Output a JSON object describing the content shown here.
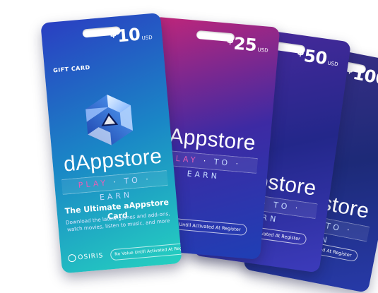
{
  "brand_name": "dAppstore",
  "tagline": {
    "p1": "PLAY",
    "p2": "TO",
    "p3": "EARN"
  },
  "gift_label": "GIFT CARD",
  "subtitle": "The Ultimate aAppstore Card",
  "description": "Download the latest games and add-ons, watch movies, listen to music, and more",
  "notice": "No Value Untill Activated At Register",
  "partner": "OSIRIS",
  "currency_symbol": "$",
  "currency_code": "USD",
  "cards": [
    {
      "amount": "100",
      "colors": [
        "#3b2f86",
        "#1d2a78",
        "#273aa8"
      ]
    },
    {
      "amount": "50",
      "colors": [
        "#4a2a9c",
        "#23278a",
        "#3c3bbb"
      ]
    },
    {
      "amount": "25",
      "colors": [
        "#c0267a",
        "#3d2aa3",
        "#1f3fb5"
      ]
    },
    {
      "amount": "10",
      "colors": [
        "#2a3fc2",
        "#1a86c6",
        "#25d0c0"
      ]
    }
  ]
}
